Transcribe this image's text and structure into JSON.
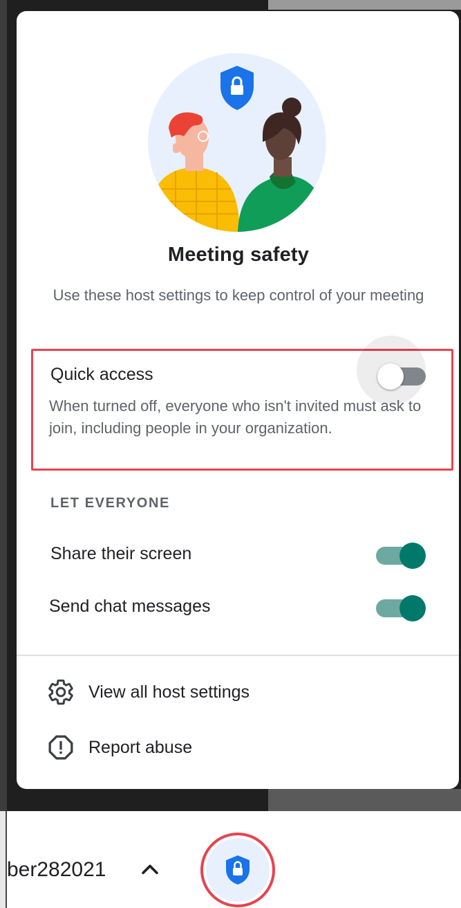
{
  "panel": {
    "title": "Meeting safety",
    "subtitle": "Use these host settings to keep control of your meeting",
    "quick_access": {
      "label": "Quick access",
      "description": "When turned off, everyone who isn't invited must ask to join, including people in your organization.",
      "enabled": false
    },
    "let_everyone": {
      "section_label": "LET EVERYONE",
      "items": [
        {
          "label": "Share their screen",
          "enabled": true
        },
        {
          "label": "Send chat messages",
          "enabled": true
        }
      ]
    },
    "menu": [
      {
        "label": "View all host settings",
        "icon": "gear-icon"
      },
      {
        "label": "Report abuse",
        "icon": "report-icon"
      }
    ]
  },
  "bottom_bar": {
    "meeting_code": "ber282021",
    "chevron": "chevron-up-icon",
    "host_controls_icon": "shield-lock-icon"
  },
  "colors": {
    "accent_teal": "#00796b",
    "highlight_red": "#e8434d",
    "shield_blue": "#1a73e8"
  }
}
